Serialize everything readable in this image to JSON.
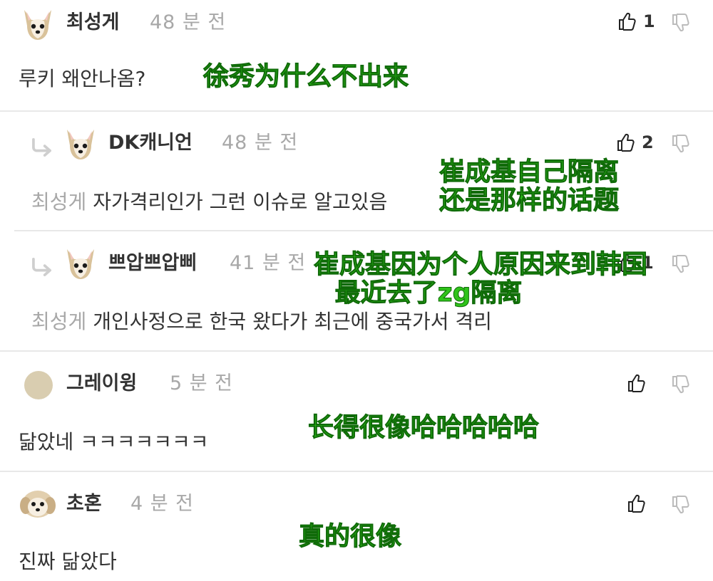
{
  "comments": [
    {
      "username": "최성게",
      "time": "48 분 전",
      "body": "루키 왜안나옴?",
      "likes": "1",
      "overlay": "徐秀为什么不出来"
    },
    {
      "username": "DK캐니언",
      "time": "48 분 전",
      "mention": "최성게",
      "body": "자가격리인가 그런 이슈로 알고있음",
      "likes": "2",
      "overlay_line1": "崔成基自己隔离",
      "overlay_line2": "还是那样的话题"
    },
    {
      "username": "쁘압쁘압삐",
      "time": "41 분 전",
      "mention": "최성게",
      "body": "개인사정으로 한국 왔다가 최근에 중국가서 격리",
      "likes": "1",
      "overlay_line1": "崔成基因为个人原因来到韩国",
      "overlay_line2": "最近去了zg隔离"
    },
    {
      "username": "그레이윙",
      "time": "5 분 전",
      "body": "닮았네 ㅋㅋㅋㅋㅋㅋㅋ",
      "overlay": "长得很像哈哈哈哈哈"
    },
    {
      "username": "초혼",
      "time": "4 분 전",
      "body": "진짜 닮았다",
      "overlay": "真的很像"
    }
  ],
  "icons": {
    "like": "thumbs-up-icon",
    "dislike": "thumbs-down-icon",
    "reply": "reply-arrow-icon"
  },
  "colors": {
    "overlay_text": "#2fc31a",
    "muted_text": "#a8a8a8",
    "divider": "#e8e8e8"
  }
}
